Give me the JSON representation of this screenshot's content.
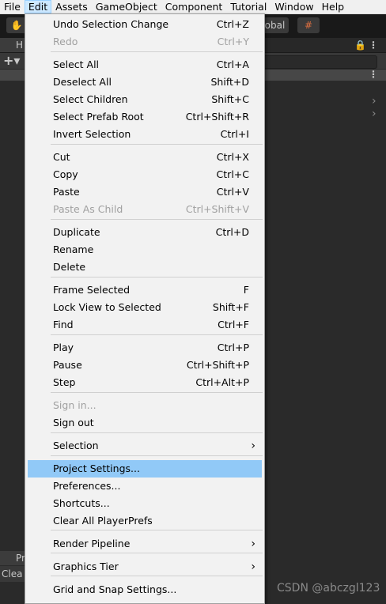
{
  "menubar": [
    "File",
    "Edit",
    "Assets",
    "GameObject",
    "Component",
    "Tutorial",
    "Window",
    "Help"
  ],
  "toolbar": {
    "global_label": "obal",
    "hierarchy_tab": "H",
    "project_tab": "Pr",
    "console_clear": "Clea"
  },
  "edit_menu": {
    "items": [
      {
        "label": "Undo Selection Change",
        "shortcut": "Ctrl+Z"
      },
      {
        "label": "Redo",
        "shortcut": "Ctrl+Y",
        "disabled": true
      },
      {
        "label": "Select All",
        "shortcut": "Ctrl+A"
      },
      {
        "label": "Deselect All",
        "shortcut": "Shift+D"
      },
      {
        "label": "Select Children",
        "shortcut": "Shift+C"
      },
      {
        "label": "Select Prefab Root",
        "shortcut": "Ctrl+Shift+R"
      },
      {
        "label": "Invert Selection",
        "shortcut": "Ctrl+I"
      },
      {
        "label": "Cut",
        "shortcut": "Ctrl+X"
      },
      {
        "label": "Copy",
        "shortcut": "Ctrl+C"
      },
      {
        "label": "Paste",
        "shortcut": "Ctrl+V"
      },
      {
        "label": "Paste As Child",
        "shortcut": "Ctrl+Shift+V",
        "disabled": true
      },
      {
        "label": "Duplicate",
        "shortcut": "Ctrl+D"
      },
      {
        "label": "Rename",
        "shortcut": ""
      },
      {
        "label": "Delete",
        "shortcut": ""
      },
      {
        "label": "Frame Selected",
        "shortcut": "F"
      },
      {
        "label": "Lock View to Selected",
        "shortcut": "Shift+F"
      },
      {
        "label": "Find",
        "shortcut": "Ctrl+F"
      },
      {
        "label": "Play",
        "shortcut": "Ctrl+P"
      },
      {
        "label": "Pause",
        "shortcut": "Ctrl+Shift+P"
      },
      {
        "label": "Step",
        "shortcut": "Ctrl+Alt+P"
      },
      {
        "label": "Sign in...",
        "shortcut": "",
        "disabled": true
      },
      {
        "label": "Sign out",
        "shortcut": ""
      },
      {
        "label": "Selection",
        "shortcut": "",
        "submenu": true
      },
      {
        "label": "Project Settings...",
        "shortcut": "",
        "highlighted": true
      },
      {
        "label": "Preferences...",
        "shortcut": ""
      },
      {
        "label": "Shortcuts...",
        "shortcut": ""
      },
      {
        "label": "Clear All PlayerPrefs",
        "shortcut": ""
      },
      {
        "label": "Render Pipeline",
        "shortcut": "",
        "submenu": true
      },
      {
        "label": "Graphics Tier",
        "shortcut": "",
        "submenu": true
      },
      {
        "label": "Grid and Snap Settings...",
        "shortcut": ""
      }
    ]
  },
  "watermark": "CSDN @abczgl123",
  "colors": {
    "highlight": "#91c9f7",
    "menu_bg": "#f2f2f2",
    "editor_bg": "#2a2a2a",
    "menubar_active": "#cce8ff"
  }
}
